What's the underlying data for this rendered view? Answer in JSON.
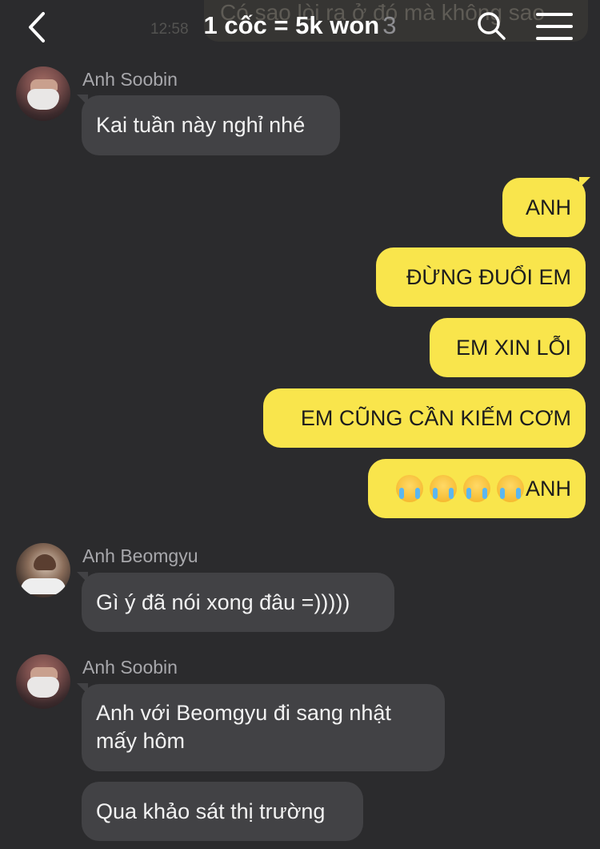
{
  "header": {
    "title": "1 cốc = 5k won",
    "member_count": "3",
    "background_message_text": "Có sao lòi ra ở đó mà không sao",
    "background_message_time": "12:58"
  },
  "colors": {
    "background": "#2b2b2d",
    "incoming_bubble": "#424245",
    "outgoing_bubble": "#f9e54c",
    "sender_name": "#a8a8ac"
  },
  "messages": [
    {
      "sender": "Anh Soobin",
      "direction": "incoming",
      "text": "Kai tuần này nghỉ nhé"
    },
    {
      "direction": "outgoing",
      "text": "ANH"
    },
    {
      "direction": "outgoing",
      "text": "ĐỪNG ĐUỔI EM"
    },
    {
      "direction": "outgoing",
      "text": "EM XIN LỖI"
    },
    {
      "direction": "outgoing",
      "text": "EM CŨNG CẦN KIẾM CƠM"
    },
    {
      "direction": "outgoing",
      "text": "ANH",
      "emoji": "😭",
      "emoji_count": 4
    },
    {
      "sender": "Anh Beomgyu",
      "direction": "incoming",
      "text": "Gì ý đã nói xong đâu =)))))"
    },
    {
      "sender": "Anh Soobin",
      "direction": "incoming",
      "text": "Anh với Beomgyu đi sang nhật mấy hôm"
    },
    {
      "sender": "Anh Soobin",
      "direction": "incoming",
      "text": "Qua khảo sát thị trường"
    }
  ],
  "icons": {
    "back": "chevron-left-icon",
    "search": "search-icon",
    "menu": "hamburger-menu-icon"
  }
}
